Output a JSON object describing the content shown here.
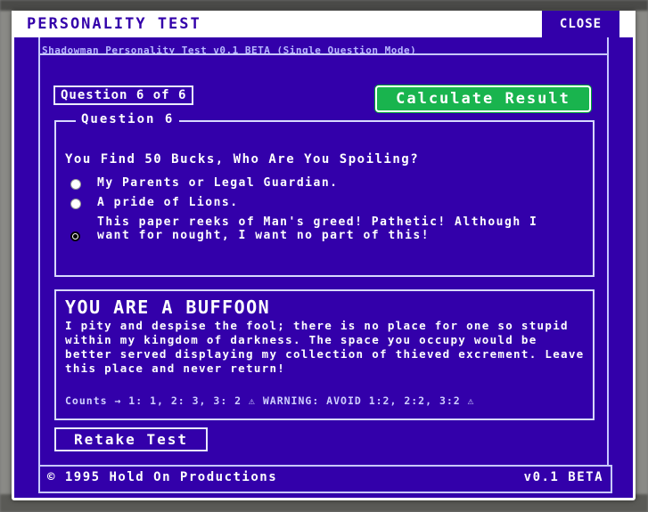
{
  "modal": {
    "title": "PERSONALITY TEST",
    "close_label": "CLOSE",
    "subtitle": "Shadowman Personality Test v0.1 BETA (Single Question Mode)"
  },
  "test": {
    "counter": "Question 6 of 6",
    "calculate_label": "Calculate Result",
    "question_legend": "Question 6",
    "question_text": "You Find 50 Bucks, Who Are You Spoiling?",
    "options": [
      {
        "label": "My Parents or Legal Guardian.",
        "selected": false
      },
      {
        "label": "A pride of Lions.",
        "selected": false
      },
      {
        "label": "This paper reeks of Man's greed! Pathetic! Although I want for nought, I want no part of this!",
        "selected": true
      }
    ]
  },
  "result": {
    "title": "YOU ARE A BUFFOON",
    "description": "I pity and despise the fool; there is no place for one so stupid within my kingdom of darkness. The space you occupy would be better served displaying my collection of thieved excrement. Leave this place and never return!",
    "counts": "Counts → 1: 1, 2: 3, 3: 2 ⚠ WARNING: AVOID 1:2, 2:2, 3:2 ⚠"
  },
  "retake_label": "Retake Test",
  "footer": {
    "copyright": "© 1995 Hold On Productions",
    "version": "v0.1 BETA"
  },
  "colors": {
    "panel": "#3300aa",
    "accent_button": "#19b44e",
    "text": "#ffffff"
  }
}
